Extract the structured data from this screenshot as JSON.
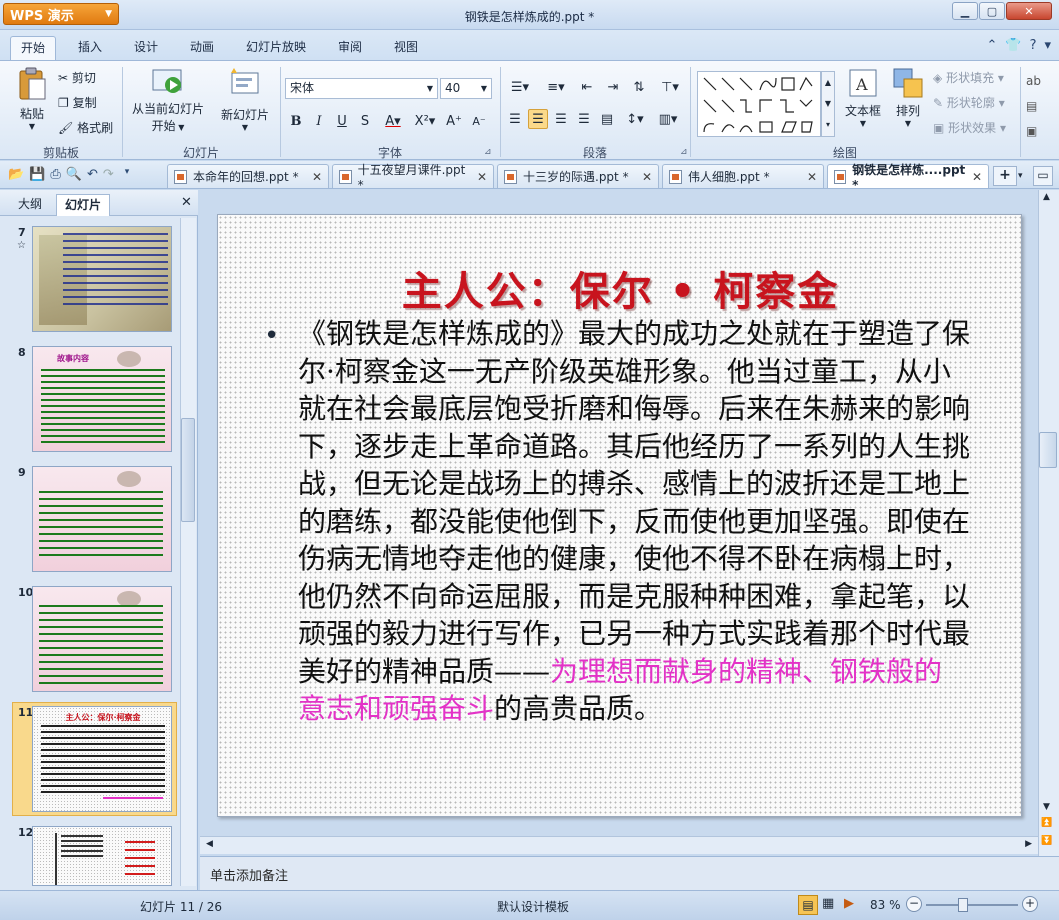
{
  "app": {
    "name": "WPS 演示",
    "title": "钢铁是怎样炼成的.ppt *"
  },
  "tabs": [
    "开始",
    "插入",
    "设计",
    "动画",
    "幻灯片放映",
    "审阅",
    "视图"
  ],
  "ribbon": {
    "clipboard": {
      "paste": "粘贴",
      "cut": "剪切",
      "copy": "复制",
      "format_painter": "格式刷",
      "label": "剪贴板"
    },
    "slides": {
      "from_current_1": "从当前幻灯片",
      "from_current_2": "开始",
      "new_slide": "新幻灯片",
      "label": "幻灯片"
    },
    "font": {
      "name": "宋体",
      "size": "40",
      "label": "字体"
    },
    "paragraph": {
      "label": "段落"
    },
    "drawing": {
      "textbox": "文本框",
      "arrange": "排列",
      "fill": "形状填充",
      "outline": "形状轮廓",
      "effect": "形状效果",
      "label": "绘图"
    }
  },
  "doc_tabs": [
    "本命年的回想.ppt *",
    "十五夜望月课件.ppt *",
    "十三岁的际遇.ppt *",
    "伟人细胞.ppt *",
    "钢铁是怎样炼....ppt *"
  ],
  "left_panel": {
    "tabs": [
      "大纲",
      "幻灯片"
    ],
    "slide_numbers": [
      "7",
      "8",
      "9",
      "10",
      "11",
      "12"
    ]
  },
  "thumbs": {
    "t8_title": "故事内容",
    "t11_title": "主人公：保尔·柯察金"
  },
  "slide": {
    "title": "主人公：保尔 • 柯察金",
    "bullet": "•",
    "body_plain": "《钢铁是怎样炼成的》最大的成功之处就在于塑造了保尔·柯察金这一无产阶级英雄形象。他当过童工，从小就在社会最底层饱受折磨和侮辱。后来在朱赫来的影响下，逐步走上革命道路。其后他经历了一系列的人生挑战，但无论是战场上的搏杀、感情上的波折还是工地上的磨练，都没能使他倒下，反而使他更加坚强。即使在伤病无情地夺走他的健康，使他不得不卧在病榻上时，他仍然不向命运屈服，而是克服种种困难，拿起笔，以顽强的毅力进行写作，已另一种方式实践着那个时代最美好的精神品质——",
    "body_highlight": "为理想而献身的精神、钢铁般的意志和顽强奋斗",
    "body_end": "的高贵品质。"
  },
  "notes": "单击添加备注",
  "status": {
    "slide_count": "幻灯片 11 / 26",
    "template": "默认设计模板",
    "zoom": "83 %"
  },
  "colors": {
    "title_red": "#c8141e",
    "highlight_magenta": "#e332c7",
    "selected_thumb": "#f5c64e"
  }
}
